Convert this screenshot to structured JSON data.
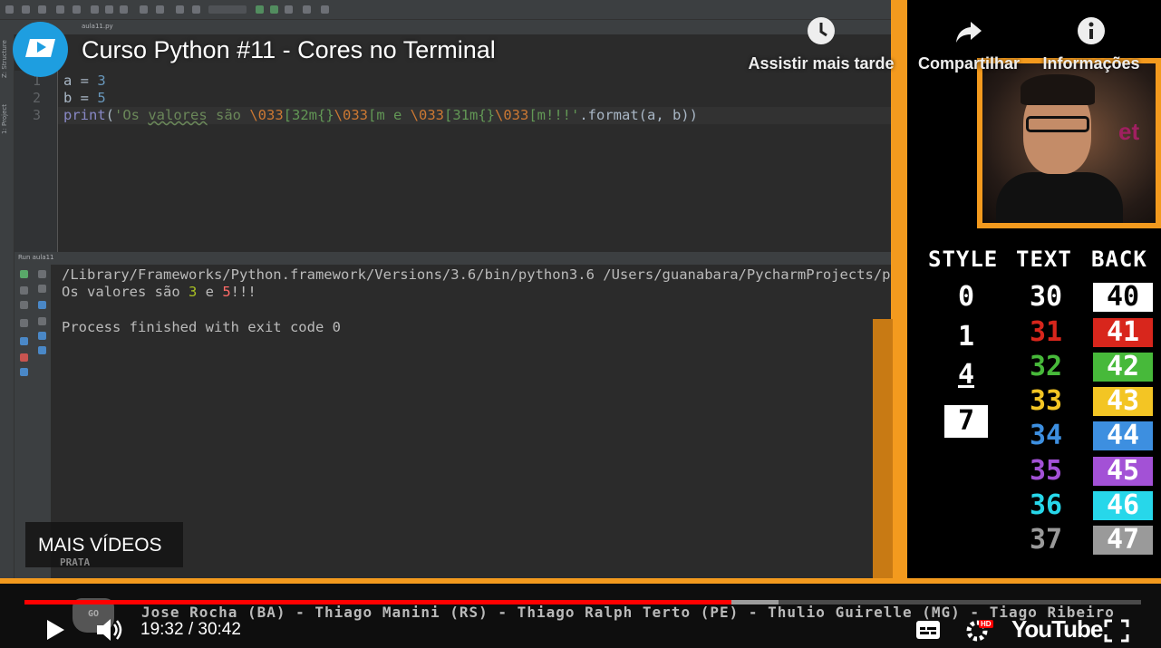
{
  "video": {
    "title": "Curso Python #11 - Cores no Terminal",
    "current_time": "19:32 / 30:42",
    "progress": 0.633,
    "buffered": 0.675
  },
  "top_actions": [
    {
      "label": "Assistir mais tarde",
      "icon": "clock-icon"
    },
    {
      "label": "Compartilhar",
      "icon": "share-icon"
    },
    {
      "label": "Informações",
      "icon": "info-icon"
    }
  ],
  "ide": {
    "file_tab": "aula11.py",
    "side_labels": [
      "Z: Structure",
      "1: Project"
    ],
    "run_header": "Run  aula11",
    "code_lines": [
      "1",
      "2",
      "3"
    ],
    "console": {
      "line1": "/Library/Frameworks/Python.framework/Versions/3.6/bin/python3.6 /Users/guanabara/PycharmProjects/p",
      "line2_pre": "Os valores são ",
      "line2_a": "3",
      "line2_mid": " e ",
      "line2_b": "5",
      "line2_post": "!!!",
      "line3": "Process finished with exit code 0"
    }
  },
  "code": {
    "l1_var": "a",
    "l1_op": " = ",
    "l1_val": "3",
    "l2_var": "b",
    "l2_op": " = ",
    "l2_val": "5",
    "l3_fn": "print",
    "l3_open": "(",
    "l3_s1": "'Os ",
    "l3_s2": "valores",
    "l3_s3": " são ",
    "l3_e1": "\\033",
    "l3_s4": "[32m{}",
    "l3_e2": "\\033",
    "l3_s5": "[m e ",
    "l3_e3": "\\033",
    "l3_s6": "[31m{}",
    "l3_e4": "\\033",
    "l3_s7": "[m!!!'",
    "l3_tail": ".format(a, b))"
  },
  "panel": {
    "headers": {
      "style": "STYLE",
      "text": "TEXT",
      "back": "BACK"
    },
    "style_codes": [
      "0",
      "1",
      "4",
      "7"
    ],
    "text_codes": [
      {
        "code": "30",
        "color": "#ffffff"
      },
      {
        "code": "31",
        "color": "#d8261c"
      },
      {
        "code": "32",
        "color": "#47b93a"
      },
      {
        "code": "33",
        "color": "#f3c524"
      },
      {
        "code": "34",
        "color": "#3d8fe0"
      },
      {
        "code": "35",
        "color": "#a351d6"
      },
      {
        "code": "36",
        "color": "#27d7ea"
      },
      {
        "code": "37",
        "color": "#9a9a9a"
      }
    ],
    "back_codes": [
      {
        "code": "40",
        "color": "#ffffff",
        "fg": "#000000"
      },
      {
        "code": "41",
        "color": "#d8261c",
        "fg": "#ffffff"
      },
      {
        "code": "42",
        "color": "#47b93a",
        "fg": "#ffffff"
      },
      {
        "code": "43",
        "color": "#f3c524",
        "fg": "#ffffff"
      },
      {
        "code": "44",
        "color": "#3d8fe0",
        "fg": "#ffffff"
      },
      {
        "code": "45",
        "color": "#a351d6",
        "fg": "#ffffff"
      },
      {
        "code": "46",
        "color": "#27d7ea",
        "fg": "#ffffff"
      },
      {
        "code": "47",
        "color": "#9a9a9a",
        "fg": "#ffffff"
      }
    ],
    "cam_text": "et"
  },
  "overlay": {
    "mais_videos": "MAIS VÍDEOS",
    "prata": "PRATA",
    "go": "GO",
    "ticker": "Jose Rocha (BA) - Thiago Manini (RS) - Thiago Ralph Terto (PE) - Thulio Guirelle (MG) - Tiago Ribeiro",
    "youtube": "YouTube",
    "hd": "HD"
  },
  "colors": {
    "accent": "#f39a1e",
    "progress": "#ff0000",
    "ide_bg": "#2b2b2b"
  }
}
